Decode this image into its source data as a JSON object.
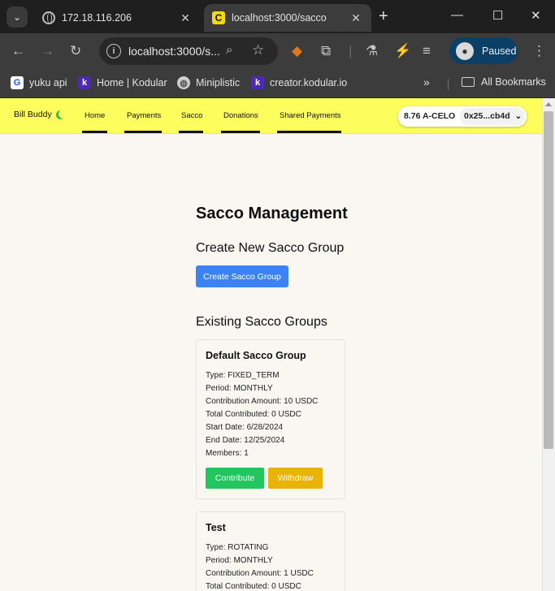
{
  "browser": {
    "tabs": [
      {
        "title": "172.18.116.206",
        "active": false,
        "favicon": "globe-icon"
      },
      {
        "title": "localhost:3000/sacco",
        "active": true,
        "favicon": "c-favicon",
        "favicon_letter": "C"
      }
    ],
    "url": "localhost:3000/s...",
    "profile_status": "Paused",
    "bookmarks": [
      {
        "label": "yuku api",
        "icon": "yuku-icon",
        "letter": "G"
      },
      {
        "label": "Home | Kodular",
        "icon": "kodular-icon",
        "letter": "k"
      },
      {
        "label": "Miniplistic",
        "icon": "globe-icon",
        "letter": ""
      },
      {
        "label": "creator.kodular.io",
        "icon": "kodular-icon",
        "letter": "k"
      }
    ],
    "all_bookmarks": "All Bookmarks"
  },
  "app": {
    "brand": "Bill Buddy",
    "nav": [
      "Home",
      "Payments",
      "Sacco",
      "Donations",
      "Shared Payments"
    ],
    "wallet": {
      "balance": "8.76 A-CELO",
      "account": "0x25...cb4d"
    }
  },
  "sacco": {
    "title": "Sacco Management",
    "create_heading": "Create New Sacco Group",
    "create_button": "Create Sacco Group",
    "existing_heading": "Existing Sacco Groups",
    "groups": [
      {
        "name": "Default Sacco Group",
        "type": "Type: FIXED_TERM",
        "period": "Period: MONTHLY",
        "contribution": "Contribution Amount: 10 USDC",
        "total": "Total Contributed: 0 USDC",
        "start": "Start Date: 6/28/2024",
        "end": "End Date: 12/25/2024",
        "members": "Members: 1",
        "contribute_label": "Contribute",
        "withdraw_label": "Withdraw"
      },
      {
        "name": "Test",
        "type": "Type: ROTATING",
        "period": "Period: MONTHLY",
        "contribution": "Contribution Amount: 1 USDC",
        "total": "Total Contributed: 0 USDC"
      }
    ]
  },
  "colors": {
    "navbar": "#fdfd5e",
    "page_bg": "#faf6f1",
    "primary": "#3b82f6",
    "success": "#22c55e",
    "warning": "#eab308"
  }
}
